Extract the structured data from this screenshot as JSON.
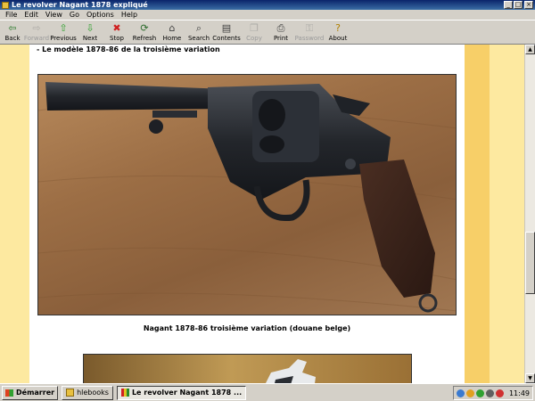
{
  "window": {
    "title": "Le revolver Nagant 1878 expliqué"
  },
  "menu": [
    "File",
    "Edit",
    "View",
    "Go",
    "Options",
    "Help"
  ],
  "toolbar": [
    {
      "label": "Back",
      "icon": "arrow-left-icon",
      "glyph": "⇦",
      "color": "#2a7a2a",
      "disabled": false
    },
    {
      "label": "Forward",
      "icon": "arrow-right-icon",
      "glyph": "⇨",
      "color": "#808080",
      "disabled": true
    },
    {
      "label": "Previous",
      "icon": "arrow-up-icon",
      "glyph": "⇧",
      "color": "#2ea02e",
      "disabled": false
    },
    {
      "label": "Next",
      "icon": "arrow-down-icon",
      "glyph": "⇩",
      "color": "#2ea02e",
      "disabled": false
    },
    {
      "label": "Stop",
      "icon": "stop-icon",
      "glyph": "✖",
      "color": "#d02020",
      "disabled": false
    },
    {
      "label": "Refresh",
      "icon": "refresh-icon",
      "glyph": "⟳",
      "color": "#2a6a2a",
      "disabled": false
    },
    {
      "label": "Home",
      "icon": "home-icon",
      "glyph": "⌂",
      "color": "#404040",
      "disabled": false
    },
    {
      "label": "Search",
      "icon": "search-icon",
      "glyph": "⌕",
      "color": "#404040",
      "disabled": false
    },
    {
      "label": "Contents",
      "icon": "contents-icon",
      "glyph": "▤",
      "color": "#404040",
      "disabled": false
    },
    {
      "label": "Copy",
      "icon": "copy-icon",
      "glyph": "❐",
      "color": "#808080",
      "disabled": true
    },
    {
      "label": "Print",
      "icon": "print-icon",
      "glyph": "⎙",
      "color": "#404040",
      "disabled": false
    },
    {
      "label": "Password",
      "icon": "key-icon",
      "glyph": "⚿",
      "color": "#808080",
      "disabled": true
    },
    {
      "label": "About",
      "icon": "about-icon",
      "glyph": "?",
      "color": "#b08000",
      "disabled": false
    }
  ],
  "content": {
    "heading": "- Le modèle 1878-86 de la troisième variation",
    "caption": "Nagant 1878-86 troisième variation (douane belge)"
  },
  "taskbar": {
    "start_label": "Démarrer",
    "tasks": [
      {
        "label": "hlebooks",
        "active": false
      },
      {
        "label": "Le revolver Nagant 1878 ...",
        "active": true
      }
    ],
    "clock": "11:49"
  },
  "colors": {
    "titlebar": "#0a246a",
    "page_background": "#fde9a0",
    "sidebar_band": "#f7cf68"
  }
}
